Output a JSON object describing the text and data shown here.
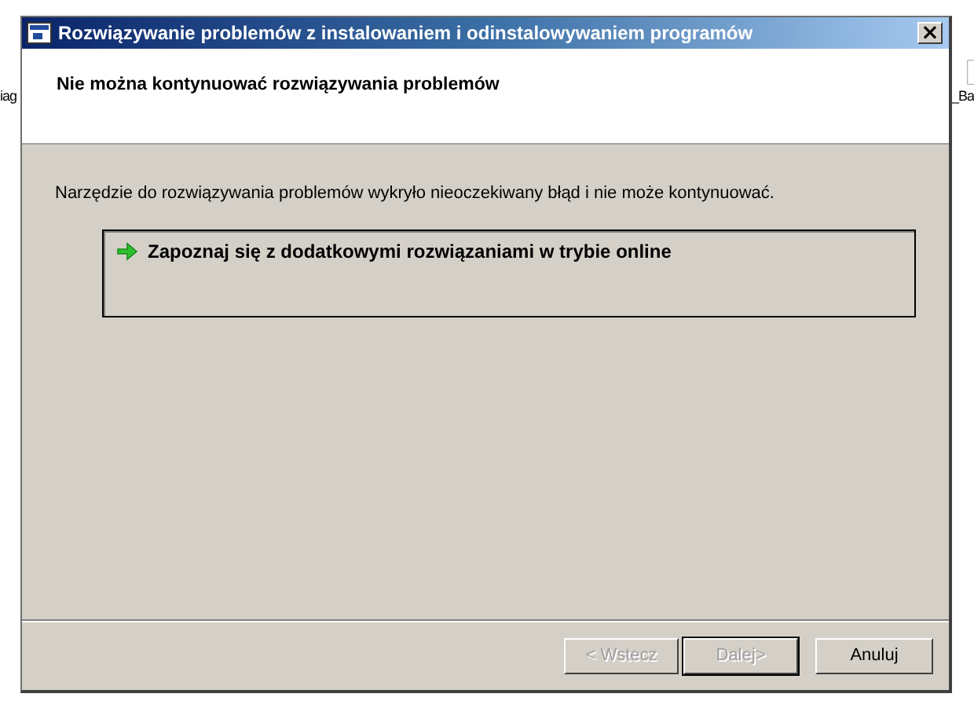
{
  "desktop_labels": [
    "iag",
    "_Ba"
  ],
  "window": {
    "title": "Rozwiązywanie problemów z instalowaniem i odinstalowywaniem programów",
    "close": "×"
  },
  "header": {
    "title": "Nie można kontynuować rozwiązywania problemów"
  },
  "message": "Narzędzie do rozwiązywania problemów wykryło nieoczekiwany błąd i nie może kontynuować.",
  "task_link": {
    "label": "Zapoznaj się z dodatkowymi rozwiązaniami w trybie online"
  },
  "buttons": [
    {
      "label": "< Wstecz",
      "disabled": true,
      "default": false
    },
    {
      "label": "Dalej>",
      "disabled": true,
      "default": true
    },
    {
      "label": "Anuluj",
      "disabled": false,
      "default": false
    }
  ]
}
